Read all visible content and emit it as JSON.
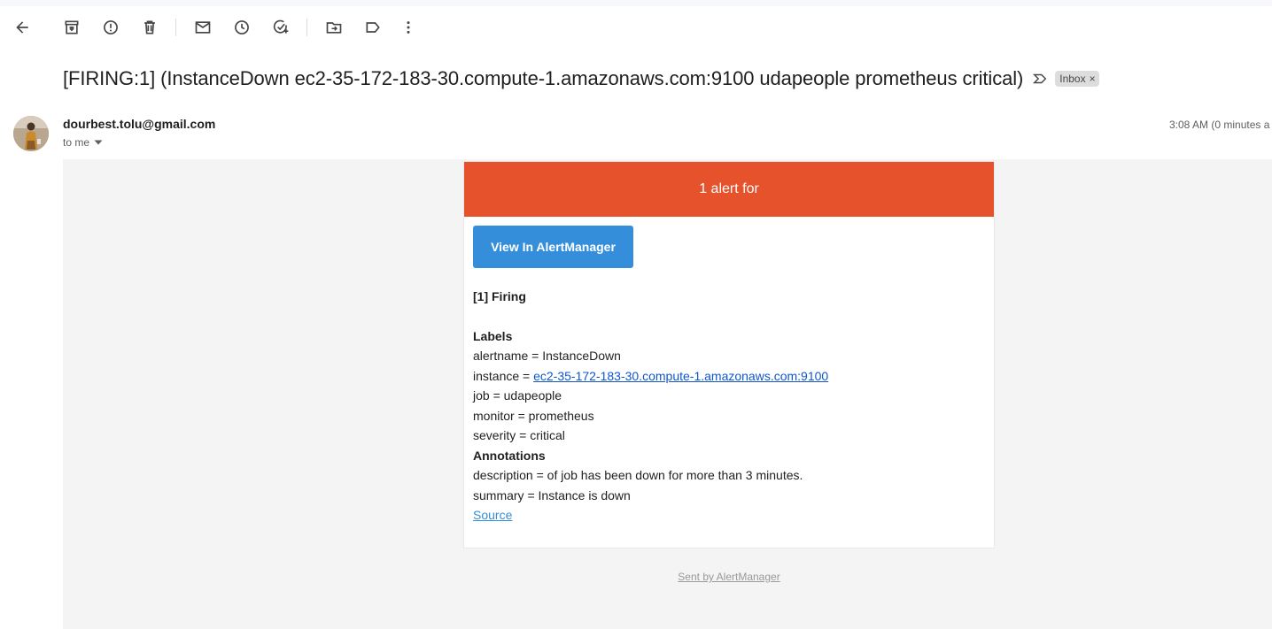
{
  "toolbar": {
    "icons": [
      "back-arrow-icon",
      "archive-icon",
      "report-spam-icon",
      "delete-icon",
      "mark-unread-icon",
      "snooze-icon",
      "add-task-icon",
      "move-to-icon",
      "label-icon",
      "more-vertical-icon"
    ]
  },
  "email": {
    "subject": "[FIRING:1] (InstanceDown ec2-35-172-183-30.compute-1.amazonaws.com:9100 udapeople prometheus critical)",
    "label": "Inbox",
    "label_close": "×",
    "sender": "dourbest.tolu@gmail.com",
    "to_me": "to me",
    "time": "3:08 AM (0 minutes a"
  },
  "alert": {
    "header": "1 alert for",
    "button": "View In AlertManager",
    "firing": "[1] Firing",
    "labels_heading": "Labels",
    "labels": [
      {
        "key": "alertname = ",
        "value": "InstanceDown"
      },
      {
        "key": "instance = ",
        "value": "ec2-35-172-183-30.compute-1.amazonaws.com:9100"
      },
      {
        "key": "job = ",
        "value": "udapeople"
      },
      {
        "key": "monitor = ",
        "value": "prometheus"
      },
      {
        "key": "severity = ",
        "value": "critical"
      }
    ],
    "annotations_heading": "Annotations",
    "annotations": [
      "description = of job has been down for more than 3 minutes.",
      "summary = Instance is down"
    ],
    "source": "Source",
    "sent_by": "Sent by AlertManager"
  },
  "colors": {
    "header_bg": "#e6522c",
    "button_bg": "#348eda",
    "link": "#15c",
    "email_bg": "#f4f4f4"
  }
}
